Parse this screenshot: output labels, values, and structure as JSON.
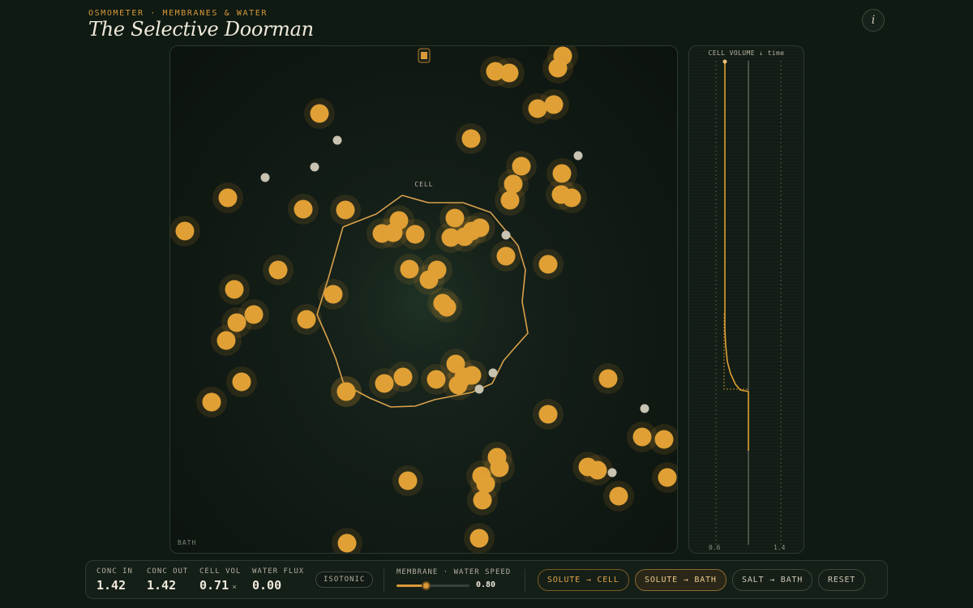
{
  "header": {
    "kicker": "OSMOMETER · MEMBRANES & WATER",
    "title": "The Selective Doorman",
    "info_label": "i"
  },
  "simulation": {
    "cell_label": "CELL",
    "bath_label": "BATH",
    "counts": {
      "solute_particles": 71,
      "water_particles": 13
    }
  },
  "chart": {
    "title": "CELL VOLUME ↓ time",
    "x_ticks": [
      "0.6",
      "1.4"
    ]
  },
  "chart_data": {
    "type": "line",
    "title": "CELL VOLUME ↓ time",
    "xlabel": "CELL VOLUME",
    "ylabel": "time",
    "xlim": [
      0.6,
      1.4
    ],
    "series": [
      {
        "x": [
          0.71,
          0.71,
          0.71,
          0.71,
          0.72,
          0.74,
          0.78,
          0.84,
          0.9,
          1.0,
          1.0
        ],
        "y": [
          0,
          150,
          300,
          330,
          350,
          370,
          385,
          398,
          405,
          407,
          480
        ]
      }
    ]
  },
  "controls": {
    "readouts": [
      {
        "label": "CONC IN",
        "value": "1.42",
        "unit": ""
      },
      {
        "label": "CONC OUT",
        "value": "1.42",
        "unit": ""
      },
      {
        "label": "CELL VOL",
        "value": "0.71",
        "unit": "×"
      },
      {
        "label": "WATER FLUX",
        "value": "0.00",
        "unit": ""
      }
    ],
    "status": "ISOTONIC",
    "slider": {
      "label": "MEMBRANE · WATER SPEED",
      "value": "0.80",
      "fraction": 0.4
    },
    "buttons": {
      "solute_cell": "SOLUTE → CELL",
      "solute_bath": "SOLUTE → BATH",
      "salt_bath": "SALT → BATH",
      "reset": "RESET"
    }
  },
  "colors": {
    "solute": "#e0a035",
    "water": "#c9c3b2",
    "accent": "#d9993a",
    "membrane": "#d9a04c"
  }
}
